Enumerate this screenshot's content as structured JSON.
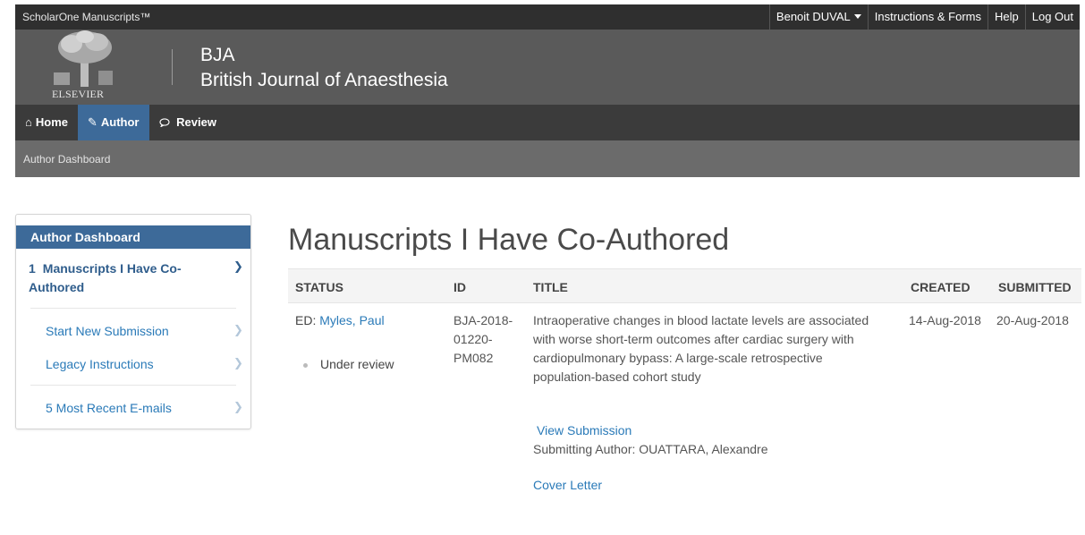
{
  "topbar": {
    "brand": "ScholarOne Manuscripts™",
    "user": "Benoit DUVAL",
    "instructions": "Instructions & Forms",
    "help": "Help",
    "logout": "Log Out"
  },
  "header": {
    "publisher": "ELSEVIER",
    "journal_short": "BJA",
    "journal_full": "British Journal of Anaesthesia"
  },
  "nav": {
    "home": "Home",
    "author": "Author",
    "review": "Review"
  },
  "breadcrumb": "Author Dashboard",
  "sidebar": {
    "heading": "Author Dashboard",
    "active_num": "1",
    "active_label": "Manuscripts I Have Co-Authored",
    "links": [
      "Start New Submission",
      "Legacy Instructions",
      "5 Most Recent E-mails"
    ]
  },
  "page_title": "Manuscripts I Have Co-Authored",
  "table": {
    "headers": [
      "STATUS",
      "ID",
      "TITLE",
      "CREATED",
      "SUBMITTED"
    ],
    "row": {
      "ed_prefix": "ED:",
      "editor": "Myles, Paul",
      "status": "Under review",
      "id_lines": [
        "BJA-2018-",
        "01220-",
        "PM082"
      ],
      "title_lines": [
        "Intraoperative changes in blood lactate levels are associated",
        "with worse short-term outcomes after cardiac surgery with",
        "cardiopulmonary bypass: A large-scale retrospective",
        "population-based cohort study"
      ],
      "view_submission": "View Submission",
      "submitting_author": "Submitting Author: OUATTARA, Alexandre",
      "cover_letter": "Cover Letter",
      "created": "14-Aug-2018",
      "submitted": "20-Aug-2018"
    }
  },
  "colors": {
    "topbar": "#2f2f2f",
    "header": "#5a5a5a",
    "nav": "#3b3b3b",
    "accent": "#3d6a99",
    "breadcrumb_bar": "#6b6b6b",
    "link": "#2a7ab8"
  },
  "icons": {
    "home": "home-icon",
    "author": "pencil-icon",
    "review": "speech-bubble-icon",
    "user_menu": "caret-down-icon",
    "chevron": "chevron-right-icon"
  }
}
